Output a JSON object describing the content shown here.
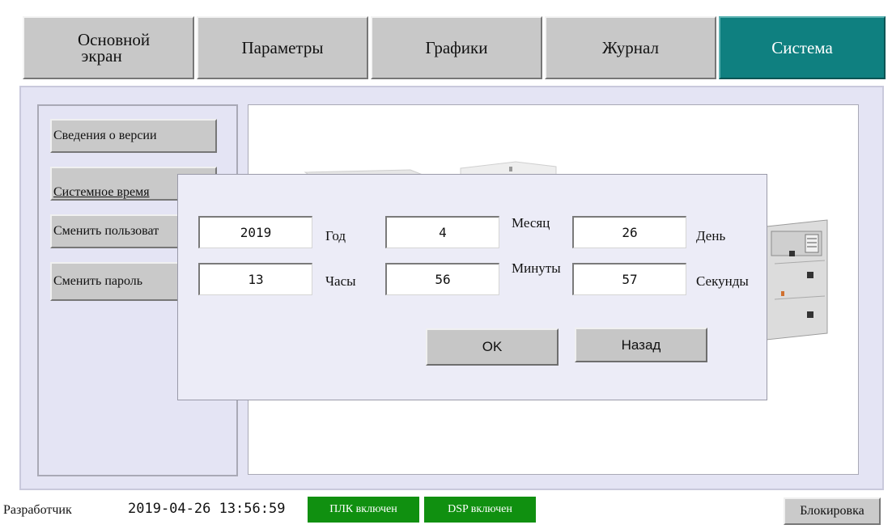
{
  "tabs": [
    {
      "line1": "Основной",
      "line2": "экран"
    },
    {
      "label": "Параметры"
    },
    {
      "label": "Графики"
    },
    {
      "label": "Журнал"
    },
    {
      "label": "Система",
      "active": true
    }
  ],
  "sidebar": {
    "items": [
      {
        "label": "Сведения о версии"
      },
      {
        "label": "Системное время"
      },
      {
        "label": "Сменить пользоват"
      },
      {
        "label": "Сменить пароль"
      }
    ]
  },
  "dialog": {
    "fields": [
      {
        "value": "2019",
        "label": "Год"
      },
      {
        "value": "4",
        "label": "Месяц"
      },
      {
        "value": "26",
        "label": "День"
      },
      {
        "value": "13",
        "label": "Часы"
      },
      {
        "value": "56",
        "label": "Минуты"
      },
      {
        "value": "57",
        "label": "Секунды"
      }
    ],
    "ok_label": "OK",
    "back_label": "Назад"
  },
  "status": {
    "user": "Разработчик",
    "datetime": "2019-04-26 13:56:59",
    "plc": "ПЛК включен",
    "dsp": "DSP включен",
    "lock_label": "Блокировка"
  },
  "colors": {
    "active_tab": "#0f8080",
    "status_ok": "#109010",
    "panel_bg": "#e4e4f4"
  },
  "icons": {
    "equipment_image": "electrical-cabinet-image"
  }
}
